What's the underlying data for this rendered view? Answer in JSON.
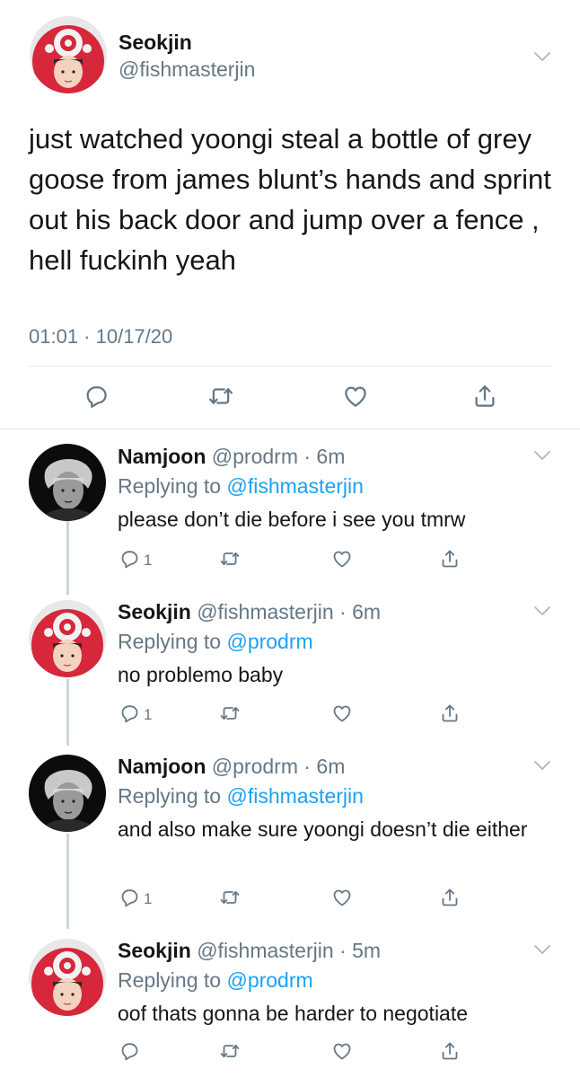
{
  "main_tweet": {
    "name": "Seokjin",
    "handle": "@fishmasterjin",
    "text": "just watched yoongi steal a bottle of grey goose from james blunt’s hands and sprint out his back door and jump over a fence , hell fuckinh yeah",
    "timestamp": "01:01 · 10/17/20"
  },
  "replies": [
    {
      "name": "Namjoon",
      "handle": "@prodrm",
      "time": "· 6m",
      "replying_prefix": "Replying to",
      "replying_to": "@fishmasterjin",
      "text": "please don’t die before i see you tmrw",
      "reply_count": "1"
    },
    {
      "name": "Seokjin",
      "handle": "@fishmasterjin",
      "time": "· 6m",
      "replying_prefix": "Replying to",
      "replying_to": "@prodrm",
      "text": "no problemo baby",
      "reply_count": "1"
    },
    {
      "name": "Namjoon",
      "handle": "@prodrm",
      "time": "· 6m",
      "replying_prefix": "Replying to",
      "replying_to": "@fishmasterjin",
      "text": "and also make sure yoongi doesn’t die either",
      "reply_count": "1"
    },
    {
      "name": "Seokjin",
      "handle": "@fishmasterjin",
      "time": "· 5m",
      "replying_prefix": "Replying to",
      "replying_to": "@prodrm",
      "text": "oof thats gonna be harder to negotiate",
      "reply_count": ""
    }
  ],
  "icons": {
    "reply": "reply-icon",
    "retweet": "retweet-icon",
    "like": "heart-icon",
    "share": "share-icon",
    "more": "chevron-down-icon"
  },
  "colors": {
    "text": "#14171a",
    "secondary": "#657786",
    "link": "#1da1f2",
    "divider": "#e1e8ed"
  }
}
